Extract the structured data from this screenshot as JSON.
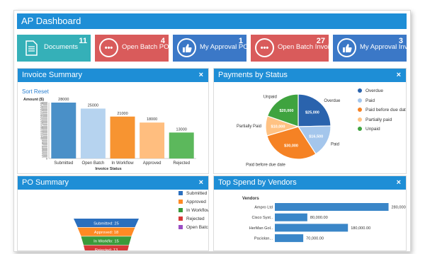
{
  "app": {
    "title": "AP Dashboard"
  },
  "tiles": [
    {
      "label": "Documents",
      "count": "11",
      "color": "#35b0b8",
      "icon": "document-icon"
    },
    {
      "label": "Open Batch POs",
      "count": "4",
      "color": "#d95b5b",
      "icon": "more-icon"
    },
    {
      "label": "My Approval POs",
      "count": "1",
      "color": "#3b78c7",
      "icon": "thumbs-up-icon"
    },
    {
      "label": "Open Batch Invoices",
      "count": "27",
      "color": "#d95b5b",
      "icon": "more-icon"
    },
    {
      "label": "My Approval Invoices",
      "count": "3",
      "color": "#3b78c7",
      "icon": "thumbs-up-icon"
    }
  ],
  "invoice_summary": {
    "title": "Invoice Summary",
    "close": "×",
    "sort_reset": "Sort Reset"
  },
  "payments_status": {
    "title": "Payments by Status",
    "close": "×"
  },
  "po_summary": {
    "title": "PO Summary",
    "close": "×"
  },
  "top_spend": {
    "title": "Top Spend by Vendors",
    "close": "×"
  },
  "chart_data": [
    {
      "type": "bar",
      "title": "",
      "ylabel": "Amount ($)",
      "xlabel": "Invoice Status",
      "ylim": [
        0,
        28000
      ],
      "yticks": [
        0,
        1000,
        2000,
        3000,
        4000,
        5000,
        6000,
        7000,
        8000,
        9000,
        10000,
        11000,
        12000,
        13000,
        14000,
        15000,
        16000,
        17000,
        18000,
        19000,
        20000,
        21000,
        22000,
        23000,
        24000,
        25000,
        26000,
        27000,
        28000
      ],
      "categories": [
        "Submitted",
        "Open Batch",
        "In Workflow",
        "Approved",
        "Rejected"
      ],
      "values": [
        28000,
        25000,
        21000,
        18000,
        13000
      ],
      "colors": [
        "#4a90c8",
        "#b6d3ef",
        "#f79431",
        "#ffbe7f",
        "#5cb85c"
      ]
    },
    {
      "type": "pie",
      "categories": [
        "Overdue",
        "Paid",
        "Paid before due date",
        "Partially paid",
        "Unpaid"
      ],
      "values": [
        25000,
        16500,
        30000,
        10000,
        20000
      ],
      "labels": [
        "$25,000",
        "$16,500",
        "$30,000",
        "$10,000",
        "$20,000"
      ],
      "outer_labels": [
        "Overdue",
        "Paid",
        "Paid before due date",
        "Partially Paid",
        "Unpaid"
      ],
      "colors": [
        "#2a63ad",
        "#a4c6ec",
        "#f58224",
        "#ffc283",
        "#3fa33f"
      ],
      "legend": "right"
    },
    {
      "type": "bar",
      "categories": [
        "Submitted: 25",
        "Approved: 18",
        "In Workflo: 15",
        "Rejected: 13"
      ],
      "values": [
        25,
        18,
        15,
        13
      ],
      "legend_entries": [
        "Submitted",
        "Approved",
        "In Workflow",
        "Rejected",
        "Open Batch"
      ],
      "colors": [
        "#2b6fbe",
        "#ff8a24",
        "#3a9a3a",
        "#d63838",
        "#9a4ec4"
      ],
      "legend": "right"
    },
    {
      "type": "bar",
      "ylabel": "Vendors",
      "categories": [
        "Ampro Ltd",
        "Cisco Syst..",
        "HerMan Gol..",
        "Paciolan..."
      ],
      "values": [
        280000,
        80000,
        180000,
        70000
      ],
      "labels": [
        "280,000.00",
        "80,000.00",
        "180,000.00",
        "70,000.00"
      ],
      "xlim": [
        0,
        300000
      ],
      "color": "#3a86c8"
    }
  ]
}
